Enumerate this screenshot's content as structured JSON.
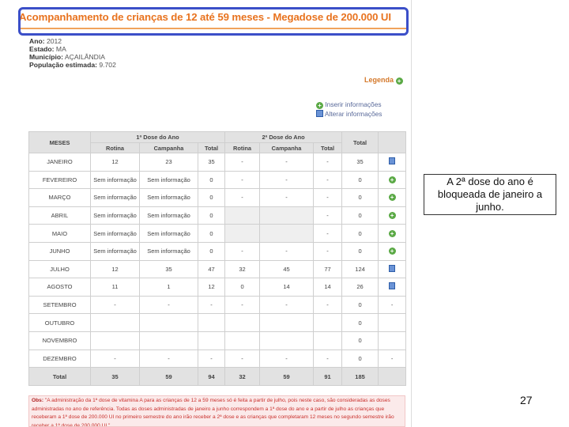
{
  "page": {
    "title": "Acompanhamento de crianças de 12 até 59 meses - Megadose de 200.000 UI",
    "info": {
      "ano_label": "Ano:",
      "ano": "2012",
      "estado_label": "Estado:",
      "estado": "MA",
      "municipio_label": "Município:",
      "municipio": "AÇAILÂNDIA",
      "populacao_label": "População estimada:",
      "populacao": "9.702"
    },
    "legenda": "Legenda",
    "legend_items": [
      "Inserir informações",
      "Alterar informações"
    ]
  },
  "table": {
    "header_group_1": "1ª Dose do Ano",
    "header_group_2": "2ª Dose do Ano",
    "col_meses": "MESES",
    "col_total": "Total",
    "sub_headers": [
      "Rotina",
      "Campanha",
      "Total",
      "Rotina",
      "Campanha",
      "Total"
    ],
    "rows": [
      {
        "mes": "JANEIRO",
        "r1": "12",
        "c1": "23",
        "t1": "35",
        "r2": "-",
        "c2": "-",
        "t2": "-",
        "total": "35",
        "icon": "edit-doc-icon"
      },
      {
        "mes": "FEVEREIRO",
        "r1": "Sem informação",
        "c1": "Sem informação",
        "t1": "0",
        "r2": "-",
        "c2": "-",
        "t2": "-",
        "total": "0",
        "icon": "add-icon"
      },
      {
        "mes": "MARÇO",
        "r1": "Sem informação",
        "c1": "Sem informação",
        "t1": "0",
        "r2": "-",
        "c2": "-",
        "t2": "-",
        "total": "0",
        "icon": "add-icon"
      },
      {
        "mes": "ABRIL",
        "r1": "Sem informação",
        "c1": "Sem informação",
        "t1": "0",
        "r2": "",
        "c2": "",
        "t2": "-",
        "total": "0",
        "icon": "add-icon",
        "blank2": true
      },
      {
        "mes": "MAIO",
        "r1": "Sem informação",
        "c1": "Sem informação",
        "t1": "0",
        "r2": "",
        "c2": "",
        "t2": "-",
        "total": "0",
        "icon": "add-icon",
        "blank2": true
      },
      {
        "mes": "JUNHO",
        "r1": "Sem informação",
        "c1": "Sem informação",
        "t1": "0",
        "r2": "-",
        "c2": "-",
        "t2": "-",
        "total": "0",
        "icon": "add-icon"
      },
      {
        "mes": "JULHO",
        "r1": "12",
        "c1": "35",
        "t1": "47",
        "r2": "32",
        "c2": "45",
        "t2": "77",
        "total": "124",
        "icon": "edit-doc-icon"
      },
      {
        "mes": "AGOSTO",
        "r1": "11",
        "c1": "1",
        "t1": "12",
        "r2": "0",
        "c2": "14",
        "t2": "14",
        "total": "26",
        "icon": "edit-doc-icon"
      },
      {
        "mes": "SETEMBRO",
        "r1": "-",
        "c1": "-",
        "t1": "-",
        "r2": "-",
        "c2": "-",
        "t2": "-",
        "total": "0",
        "icon": "dash"
      },
      {
        "mes": "OUTUBRO",
        "r1": "",
        "c1": "",
        "t1": "",
        "r2": "",
        "c2": "",
        "t2": "",
        "total": "0",
        "icon": ""
      },
      {
        "mes": "NOVEMBRO",
        "r1": "",
        "c1": "",
        "t1": "",
        "r2": "",
        "c2": "",
        "t2": "",
        "total": "0",
        "icon": ""
      },
      {
        "mes": "DEZEMBRO",
        "r1": "-",
        "c1": "-",
        "t1": "-",
        "r2": "-",
        "c2": "-",
        "t2": "-",
        "total": "0",
        "icon": "dash"
      }
    ],
    "total_row": {
      "label": "Total",
      "r1": "35",
      "c1": "59",
      "t1": "94",
      "r2": "32",
      "c2": "59",
      "t2": "91",
      "total": "185"
    }
  },
  "obs": {
    "label": "Obs:",
    "text": "\"A administração da 1ª dose de vitamina A para as crianças de 12 a 59 meses só é feita a partir de julho, pois neste caso, são consideradas as doses administradas no ano de referência. Todas as doses administradas de janeiro a junho correspondem a 1ª dose do ano e a partir de julho as crianças que receberam a 1ª dose de 200.000 UI no primeiro semestre do ano irão receber a 2ª dose e as crianças que completaram 12 meses no segundo semestre irão receber a 1ª dose de 200.000 UI.\""
  },
  "callout": "A 2ª dose do ano é bloqueada de janeiro a junho.",
  "page_number": "27"
}
